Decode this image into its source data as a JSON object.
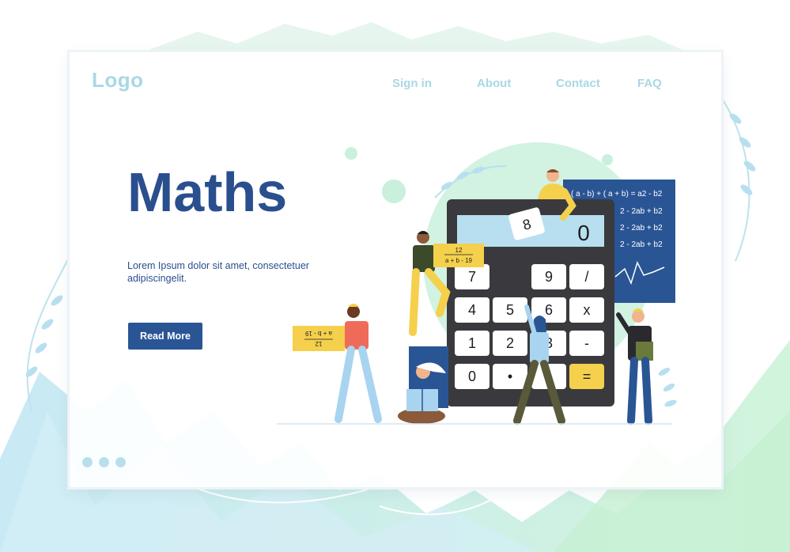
{
  "header": {
    "logo": "Logo",
    "nav": [
      {
        "id": "sign-in",
        "label": "Sign in"
      },
      {
        "id": "about",
        "label": "About"
      },
      {
        "id": "contact",
        "label": "Contact"
      },
      {
        "id": "faq",
        "label": "FAQ"
      }
    ]
  },
  "hero": {
    "title": "Maths",
    "text": "Lorem Ipsum dolor sit amet, consectetuer adipiscingelit.",
    "button": "Read More"
  },
  "illustration": {
    "calculator_display": "0",
    "card_held": "8",
    "card_left_numerator": "12",
    "card_left_denominator": "a + b - 19",
    "card_right_numerator": "12",
    "card_right_denominator": "a + b - 19",
    "board_lines": [
      "( a - b) + ( a + b) = a2 - b2",
      "2 - 2ab + b2",
      "2 - 2ab + b2",
      "2 - 2ab + b2"
    ],
    "keys": [
      "7",
      "9",
      "/",
      "4",
      "5",
      "6",
      "x",
      "1",
      "2",
      "3",
      "-",
      "0",
      "•",
      "",
      "="
    ]
  },
  "colors": {
    "primary": "#2a4f8e",
    "button": "#2a5595",
    "nav_text": "#a9d8e6",
    "calculator_body": "#3a3a3e",
    "calculator_screen": "#b8dff0",
    "accent_yellow": "#f5d04c",
    "board": "#2a5595",
    "mint": "#c9f0dc"
  },
  "slider": {
    "dots": 3
  }
}
